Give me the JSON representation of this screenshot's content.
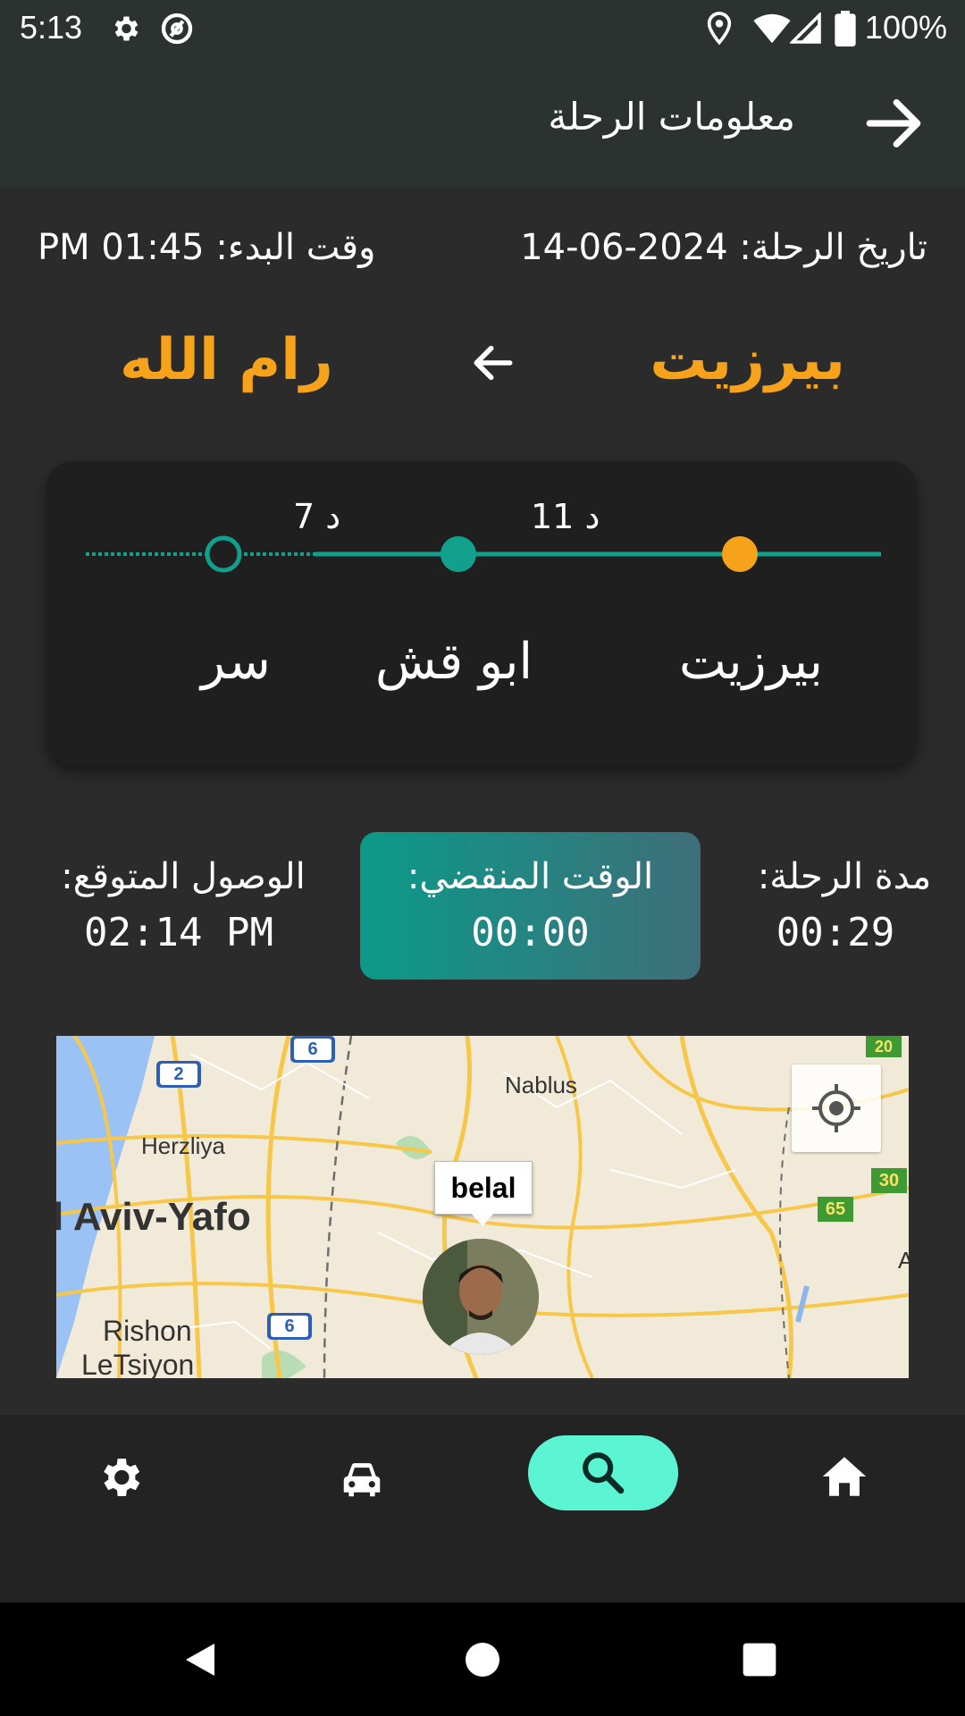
{
  "status_bar": {
    "time": "5:13",
    "battery": "100%",
    "icons": [
      "settings-gear-icon",
      "vpn-icon",
      "location-pin-icon",
      "wifi-icon",
      "signal-icon",
      "battery-icon"
    ]
  },
  "app_bar": {
    "title": "معلومات الرحلة",
    "back_icon": "arrow-right-icon"
  },
  "trip": {
    "date_text": "تاريخ الرحلة: 2024-06-14",
    "start_time_text": "وقت البدء: 01:45 PM",
    "from_city": "بيرزيت",
    "to_city": "رام الله",
    "direction_icon": "arrow-left-icon"
  },
  "route": {
    "durations": [
      "11 د",
      "7 د"
    ],
    "stops": [
      "بيرزيت",
      "ابو قش",
      "سر"
    ]
  },
  "stats": {
    "duration_label": "مدة الرحلة:",
    "duration_value": "00:29",
    "elapsed_label": "الوقت المنقضي:",
    "elapsed_value": "00:00",
    "arrival_label": "الوصول المتوقع:",
    "arrival_value": "02:14 PM"
  },
  "map": {
    "marker_label": "belal",
    "places": [
      "Nablus",
      "Herzliya",
      "l Aviv-Yafo",
      "Rishon",
      "LeTsiyon"
    ],
    "road_shields": [
      "2",
      "6",
      "6",
      "65",
      "30",
      "20"
    ],
    "edge_letter": "A"
  },
  "bottom_nav": {
    "items": [
      "settings-icon",
      "car-icon",
      "search-icon",
      "home-icon"
    ],
    "active": "search-icon"
  },
  "colors": {
    "accent_orange": "#f6a21b",
    "teal": "#0b9a88",
    "nav_active": "#5cf5d4"
  }
}
